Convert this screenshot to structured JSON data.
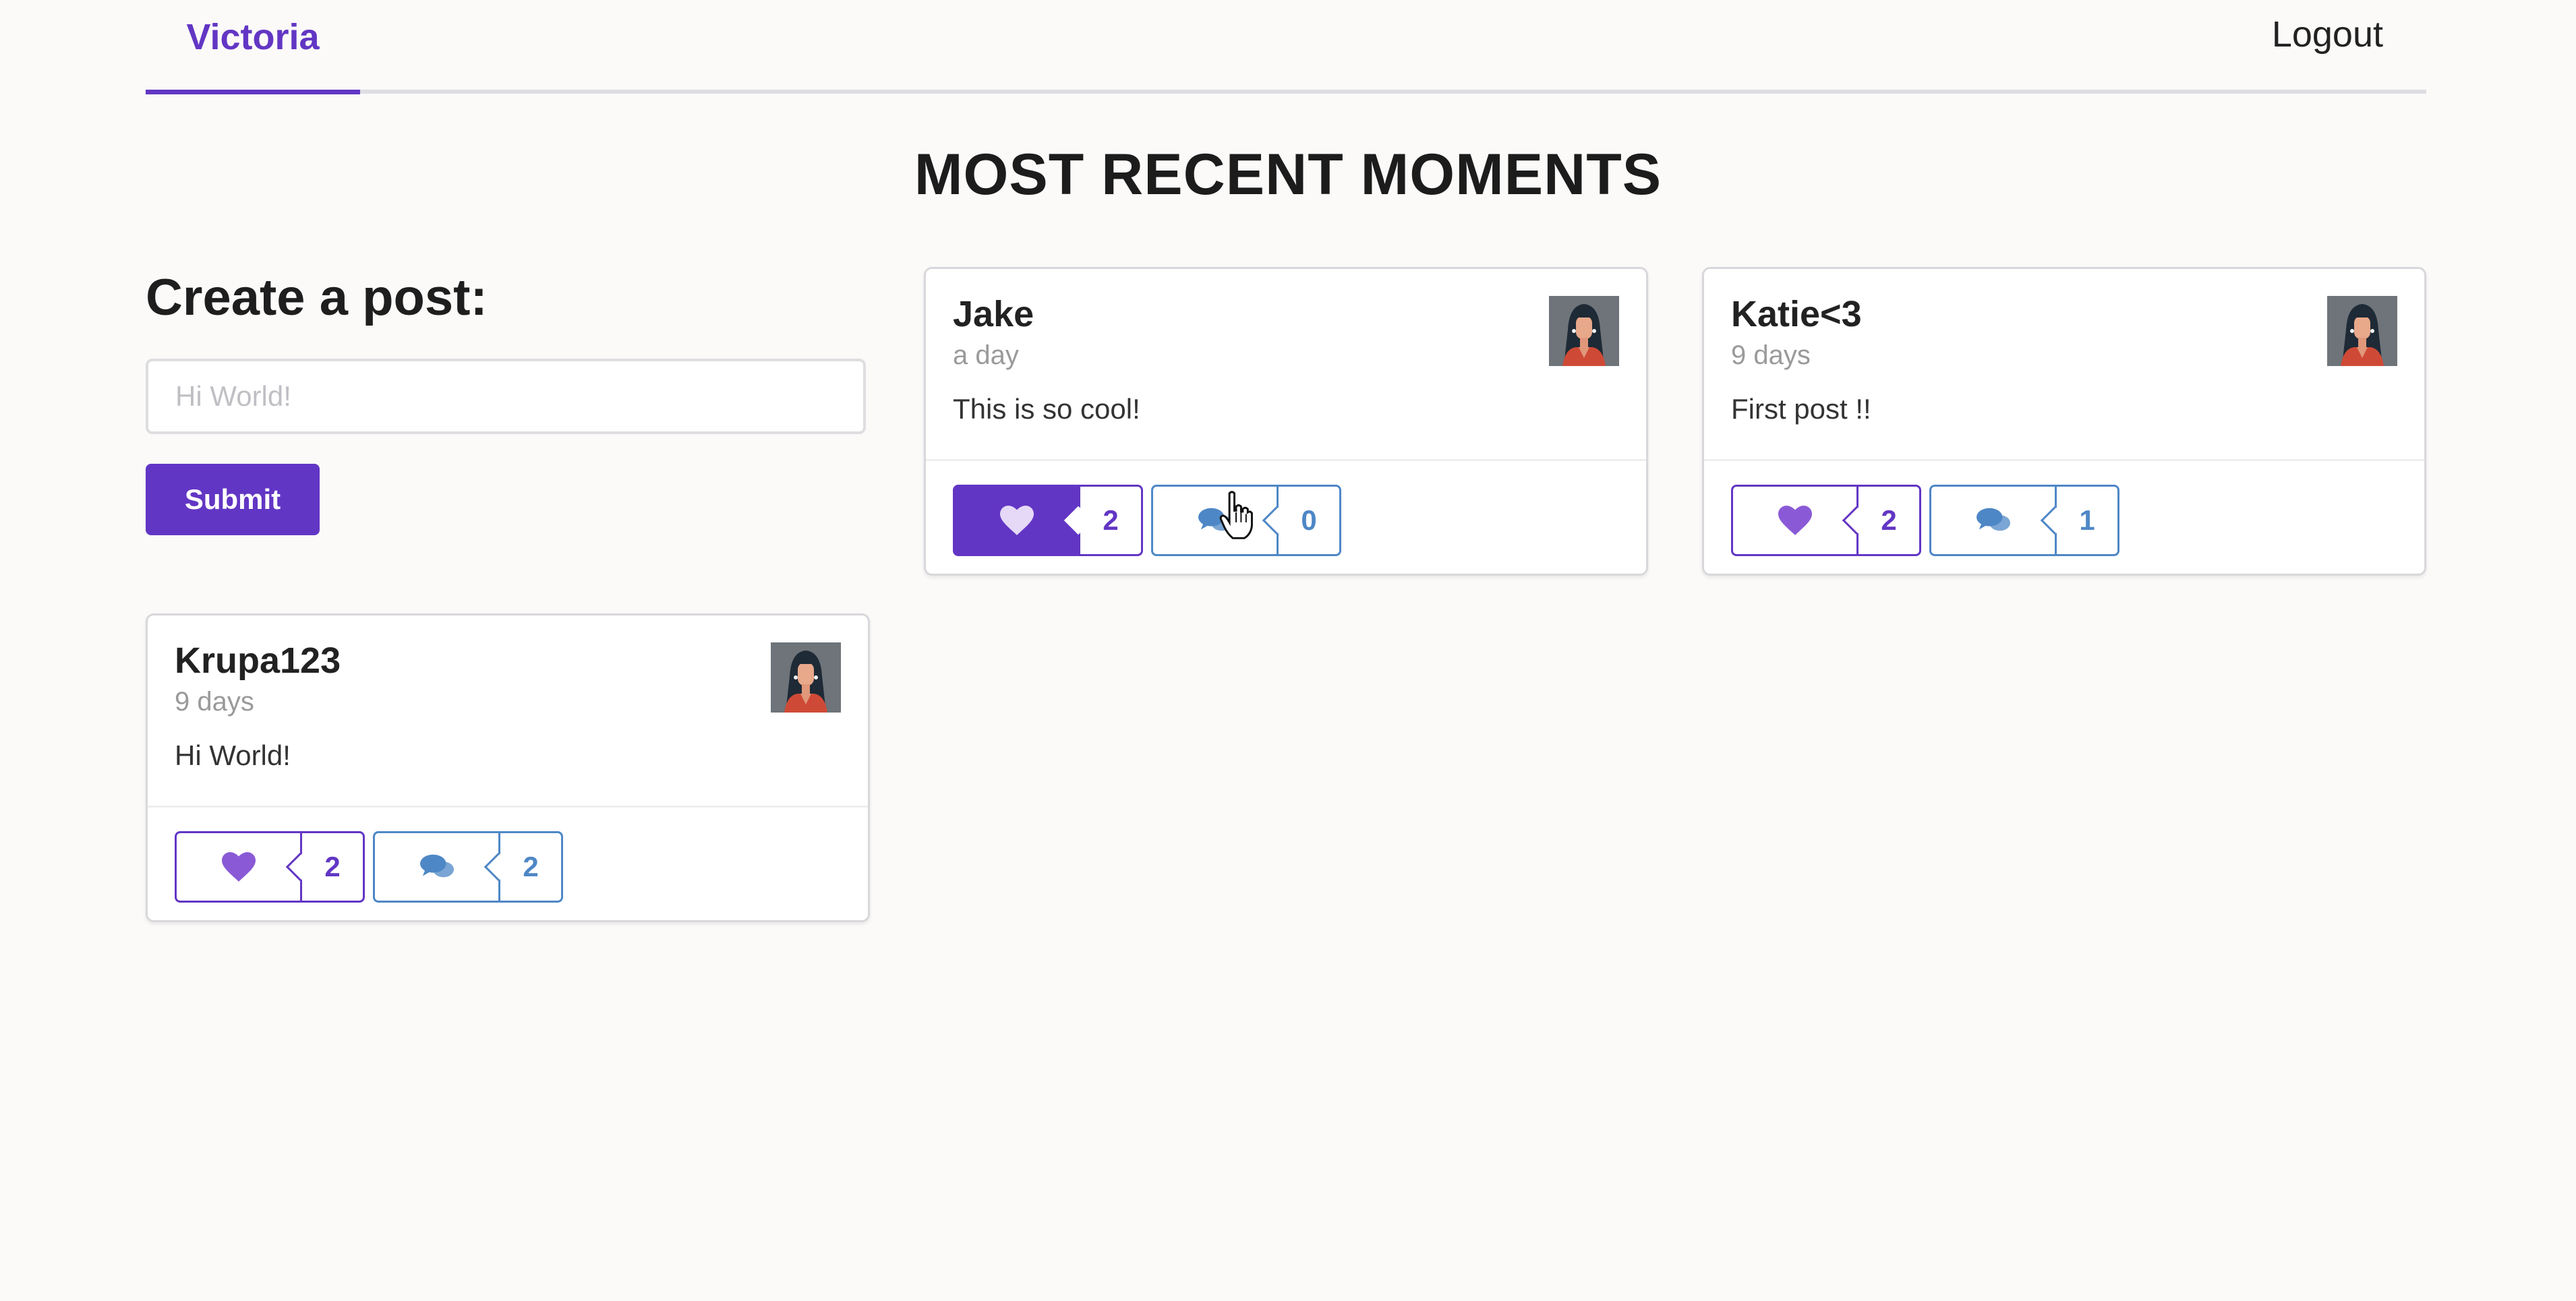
{
  "nav": {
    "user": "Victoria",
    "logout": "Logout"
  },
  "page": {
    "title": "MOST RECENT MOMENTS"
  },
  "create_post": {
    "heading": "Create a post:",
    "placeholder": "Hi World!",
    "submit_label": "Submit"
  },
  "posts": [
    {
      "user": "Jake",
      "time": "a day",
      "text": "This is so cool!",
      "likes": "2",
      "comments": "0",
      "liked": true
    },
    {
      "user": "Katie<3",
      "time": "9 days",
      "text": "First post !!",
      "likes": "2",
      "comments": "1",
      "liked": false
    },
    {
      "user": "Krupa123",
      "time": "9 days",
      "text": "Hi World!",
      "likes": "2",
      "comments": "2",
      "liked": false
    }
  ],
  "colors": {
    "accent": "#6236c4",
    "comment": "#4e87c6",
    "heart_light": "#8a5ad6"
  },
  "icons": [
    "heart-icon",
    "comment-icon",
    "avatar"
  ]
}
